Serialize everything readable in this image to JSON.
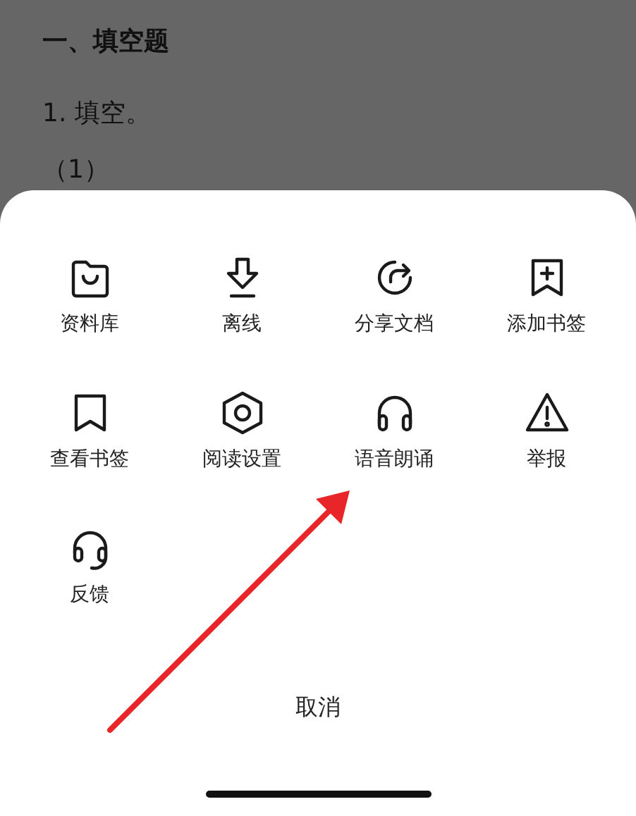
{
  "document": {
    "heading": "一、填空题",
    "lines": [
      "1.  填空。",
      "（1）"
    ]
  },
  "sheet": {
    "actions": [
      {
        "label": "资料库",
        "kind": "folder"
      },
      {
        "label": "离线",
        "kind": "download"
      },
      {
        "label": "分享文档",
        "kind": "share"
      },
      {
        "label": "添加书签",
        "kind": "bookmark-add"
      },
      {
        "label": "查看书签",
        "kind": "bookmark"
      },
      {
        "label": "阅读设置",
        "kind": "settings"
      },
      {
        "label": "语音朗诵",
        "kind": "headphones"
      },
      {
        "label": "举报",
        "kind": "warning"
      },
      {
        "label": "反馈",
        "kind": "headset"
      }
    ],
    "cancel": "取消"
  }
}
